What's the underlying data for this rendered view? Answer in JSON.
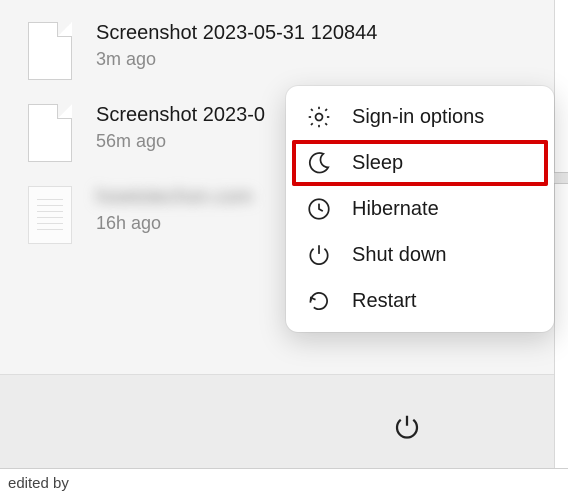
{
  "recent": [
    {
      "name": "Screenshot 2023-05-31 120844",
      "time": "3m ago",
      "thumb": "blank"
    },
    {
      "name": "Screenshot 2023-0",
      "time": "56m ago",
      "thumb": "blank"
    },
    {
      "name": "howtotechon.com",
      "time": "16h ago",
      "thumb": "doc",
      "blurred": true
    }
  ],
  "powerMenu": {
    "items": [
      {
        "label": "Sign-in options",
        "icon": "gear"
      },
      {
        "label": "Sleep",
        "icon": "moon",
        "highlighted": true
      },
      {
        "label": "Hibernate",
        "icon": "clock"
      },
      {
        "label": "Shut down",
        "icon": "power"
      },
      {
        "label": "Restart",
        "icon": "restart"
      }
    ]
  },
  "footer": {
    "text": "edited by"
  },
  "colors": {
    "highlight": "#d60000"
  }
}
